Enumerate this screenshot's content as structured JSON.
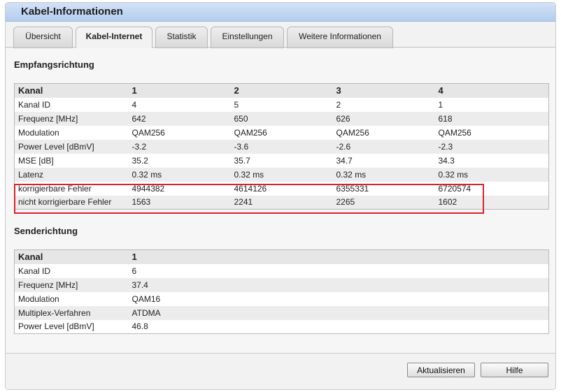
{
  "window": {
    "title": "Kabel-Informationen"
  },
  "tabs": [
    {
      "label": "Übersicht",
      "active": false
    },
    {
      "label": "Kabel-Internet",
      "active": true
    },
    {
      "label": "Statistik",
      "active": false
    },
    {
      "label": "Einstellungen",
      "active": false
    },
    {
      "label": "Weitere Informationen",
      "active": false
    }
  ],
  "downstream": {
    "title": "Empfangsrichtung",
    "header": [
      "Kanal",
      "1",
      "2",
      "3",
      "4"
    ],
    "rows": [
      [
        "Kanal ID",
        "4",
        "5",
        "2",
        "1"
      ],
      [
        "Frequenz [MHz]",
        "642",
        "650",
        "626",
        "618"
      ],
      [
        "Modulation",
        "QAM256",
        "QAM256",
        "QAM256",
        "QAM256"
      ],
      [
        "Power Level [dBmV]",
        "-3.2",
        "-3.6",
        "-2.6",
        "-2.3"
      ],
      [
        "MSE [dB]",
        "35.2",
        "35.7",
        "34.7",
        "34.3"
      ],
      [
        "Latenz",
        "0.32 ms",
        "0.32 ms",
        "0.32 ms",
        "0.32 ms"
      ],
      [
        "korrigierbare Fehler",
        "4944382",
        "4614126",
        "6355331",
        "6720574"
      ],
      [
        "nicht korrigierbare Fehler",
        "1563",
        "2241",
        "2265",
        "1602"
      ]
    ]
  },
  "upstream": {
    "title": "Senderichtung",
    "header": [
      "Kanal",
      "1"
    ],
    "rows": [
      [
        "Kanal ID",
        "6"
      ],
      [
        "Frequenz [MHz]",
        "37.4"
      ],
      [
        "Modulation",
        "QAM16"
      ],
      [
        "Multiplex-Verfahren",
        "ATDMA"
      ],
      [
        "Power Level [dBmV]",
        "46.8"
      ]
    ]
  },
  "buttons": {
    "refresh": "Aktualisieren",
    "help": "Hilfe"
  },
  "colors": {
    "highlight_border": "#d8232a",
    "title_bar": "#c3d8f2"
  }
}
